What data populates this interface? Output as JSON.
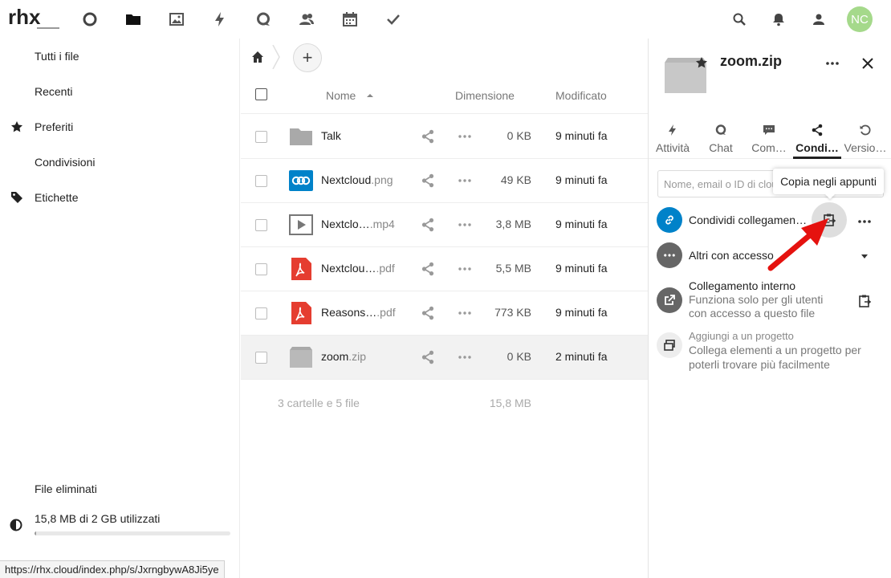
{
  "header": {
    "logo_text": "rhx",
    "apps": [
      {
        "name": "dashboard",
        "icon": "circle-icon"
      },
      {
        "name": "files",
        "icon": "folder-icon"
      },
      {
        "name": "photos",
        "icon": "image-icon"
      },
      {
        "name": "activity",
        "icon": "bolt-icon"
      },
      {
        "name": "talk",
        "icon": "chat-icon"
      },
      {
        "name": "contacts",
        "icon": "contacts-icon"
      },
      {
        "name": "calendar",
        "icon": "calendar-icon"
      },
      {
        "name": "tasks",
        "icon": "check-icon"
      }
    ],
    "avatar_initials": "NC"
  },
  "nav": {
    "items": [
      {
        "label": "Tutti i file"
      },
      {
        "label": "Recenti"
      },
      {
        "label": "Preferiti",
        "icon": "star-icon"
      },
      {
        "label": "Condivisioni"
      },
      {
        "label": "Etichette",
        "icon": "tag-icon"
      }
    ],
    "trash_label": "File eliminati",
    "quota_label": "15,8 MB di 2 GB utilizzati",
    "quota_fraction": 0.008
  },
  "status_url": "https://rhx.cloud/index.php/s/JxrngbywA8Ji5ye",
  "files": {
    "columns": {
      "name": "Nome",
      "size": "Dimensione",
      "modified": "Modificato"
    },
    "rows": [
      {
        "name": "Talk",
        "ext": "",
        "type": "folder",
        "size": "0 KB",
        "modified": "9 minuti fa"
      },
      {
        "name": "Nextcloud",
        "ext": ".png",
        "type": "image",
        "size": "49 KB",
        "modified": "9 minuti fa"
      },
      {
        "name": "Nextclo…",
        "ext": ".mp4",
        "type": "video",
        "size": "3,8 MB",
        "modified": "9 minuti fa"
      },
      {
        "name": "Nextclou…",
        "ext": ".pdf",
        "type": "pdf",
        "size": "5,5 MB",
        "modified": "9 minuti fa"
      },
      {
        "name": "Reasons…",
        "ext": ".pdf",
        "type": "pdf",
        "size": "773 KB",
        "modified": "9 minuti fa"
      },
      {
        "name": "zoom",
        "ext": ".zip",
        "type": "zip",
        "size": "0 KB",
        "modified": "2 minuti fa"
      }
    ],
    "summary_count": "3 cartelle e 5 file",
    "summary_size": "15,8 MB"
  },
  "sidebar": {
    "title": "zoom.zip",
    "tabs": [
      {
        "label": "Attività",
        "icon": "bolt-icon"
      },
      {
        "label": "Chat",
        "icon": "chat-icon"
      },
      {
        "label": "Com…",
        "icon": "comment-icon"
      },
      {
        "label": "Condi…",
        "icon": "share-icon"
      },
      {
        "label": "Versio…",
        "icon": "history-icon"
      }
    ],
    "share_placeholder": "Nome, email o ID di cloud federata…",
    "tooltip": "Copia negli appunti",
    "share_link_label": "Condividi collegamen…",
    "others_label": "Altri con accesso",
    "internal_title": "Collegamento interno",
    "internal_sub1": "Funziona solo per gli utenti",
    "internal_sub2": "con accesso a questo file",
    "project_title": "Aggiungi a un progetto",
    "project_sub1": "Collega elementi a un progetto per",
    "project_sub2": "poterli trovare più facilmente"
  },
  "colors": {
    "link_blue": "#0082c9",
    "arrow_red": "#e5120f",
    "pdf_red": "#e53d30",
    "folder_gray": "#a9a9a9"
  }
}
